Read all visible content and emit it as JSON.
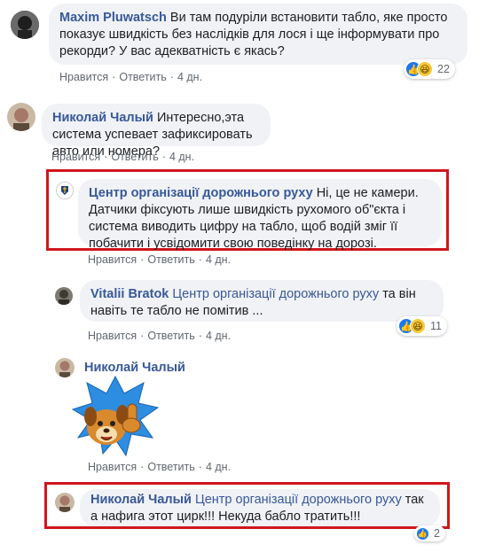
{
  "comments": [
    {
      "author": "Maxim Pluwatsch",
      "text": "Ви там подурiли встановити табло, яке просто показує швидкість без наслідків для лося і ще інформувати про рекорди? У вас адекватність є якась?",
      "like_label": "Нравится",
      "reply_label": "Ответить",
      "time": "4 дн.",
      "reactions_count": "22"
    },
    {
      "author": "Николай Чалый",
      "text": "Интересно,эта система успевает зафиксировать авто или номера?",
      "like_label": "Нравится",
      "reply_label": "Ответить",
      "time": "4 дн."
    },
    {
      "author": "Центр організації дорожнього руху",
      "text": "Ні, це не камери. Датчики фіксують лише швидкість рухомого об\"єкта і система виводить цифру на табло, щоб водій зміг її побачити і усвідомити свою поведінку на дорозі.",
      "like_label": "Нравится",
      "reply_label": "Ответить",
      "time": "4 дн."
    },
    {
      "author": "Vitalii Bratok",
      "mention": "Центр організації дорожнього руху",
      "text": "та він навіть те табло не помітив ...",
      "like_label": "Нравится",
      "reply_label": "Ответить",
      "time": "4 дн.",
      "reactions_count": "11"
    },
    {
      "author": "Николай Чалый",
      "sticker": "dog-thumbs-up-sticker",
      "like_label": "Нравится",
      "reply_label": "Ответить",
      "time": "4 дн."
    },
    {
      "author": "Николай Чалый",
      "mention": "Центр організації дорожнього руху",
      "text": "так а нафига этот цирк!!! Некуда бабло тратить!!!",
      "reactions_count": "2"
    }
  ],
  "separator": "·",
  "colors": {
    "highlight": "#d0161b",
    "link": "#385898",
    "bubble": "#f0f2f5",
    "like": "#1877f2"
  },
  "icons": {
    "like": "thumbs-up-icon",
    "haha": "laughing-face-icon"
  }
}
